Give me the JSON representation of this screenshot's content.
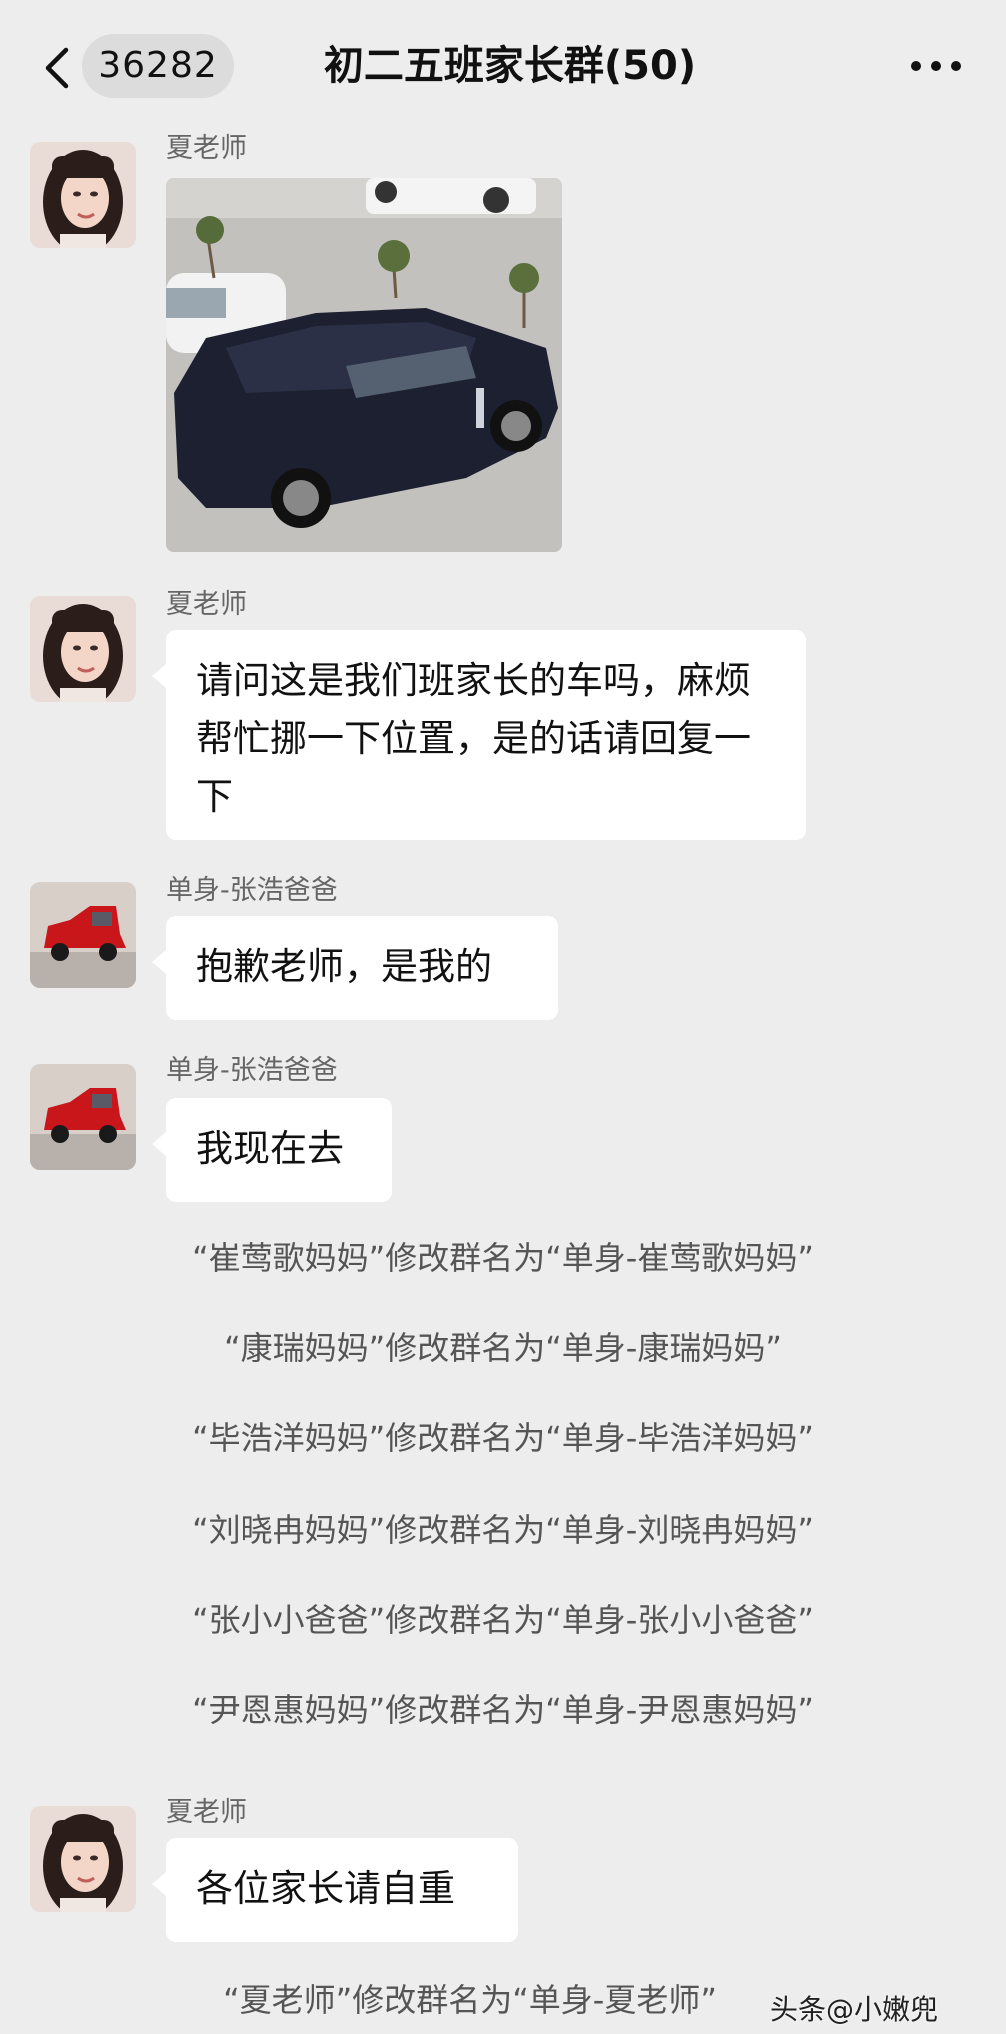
{
  "header": {
    "unread_count": "36282",
    "title": "初二五班家长群(50)"
  },
  "messages": [
    {
      "sender": "夏老师"
    },
    {
      "sender": "夏老师",
      "text": "请问这是我们班家长的车吗，麻烦帮忙挪一下位置，是的话请回复一下"
    },
    {
      "sender": "单身-张浩爸爸",
      "text": "抱歉老师，是我的"
    },
    {
      "sender": "单身-张浩爸爸",
      "text": "我现在去"
    },
    {
      "sender": "夏老师",
      "text": "各位家长请自重"
    }
  ],
  "system_messages": [
    "“崔莺歌妈妈”修改群名为“单身-崔莺歌妈妈”",
    "“康瑞妈妈”修改群名为“单身-康瑞妈妈”",
    "“毕浩洋妈妈”修改群名为“单身-毕浩洋妈妈”",
    "“刘晓冉妈妈”修改群名为“单身-刘晓冉妈妈”",
    "“张小小爸爸”修改群名为“单身-张小小爸爸”",
    "“尹恩惠妈妈”修改群名为“单身-尹恩惠妈妈”",
    "“夏老师”修改群名为“单身-夏老师”"
  ],
  "watermark": "头条@小嫩兜",
  "icons": {
    "back": "chevron-left-icon",
    "more": "more-dots-icon"
  },
  "colors": {
    "background": "#ededed",
    "bubble": "#ffffff",
    "system_text": "#555555"
  }
}
